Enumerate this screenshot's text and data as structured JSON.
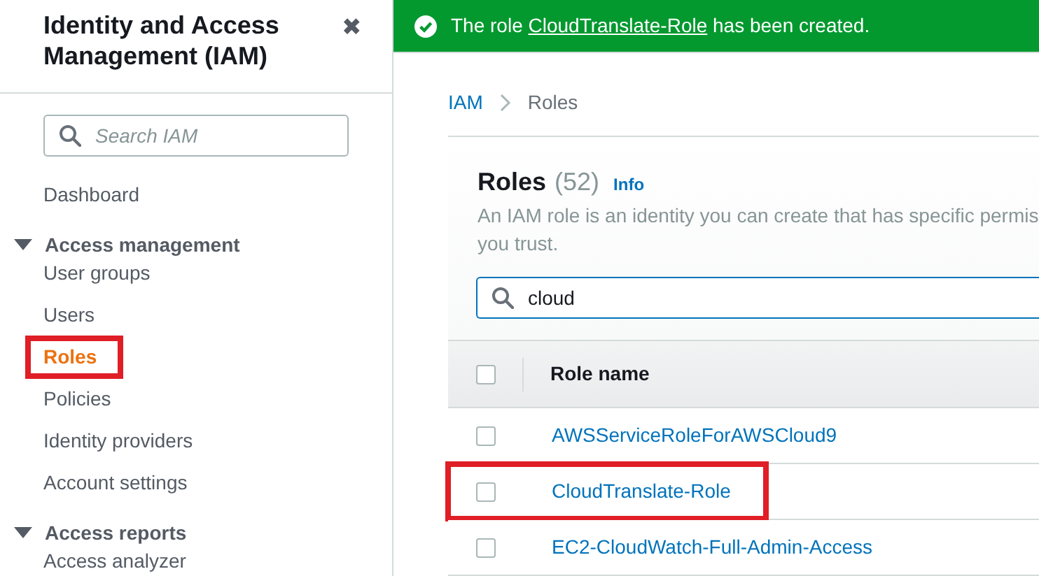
{
  "sidebar": {
    "title": "Identity and Access Management (IAM)",
    "close": "✖",
    "search": {
      "placeholder": "Search IAM"
    },
    "items": [
      {
        "kind": "link",
        "label": "Dashboard",
        "selected": false,
        "highlighted": false
      },
      {
        "kind": "section",
        "label": "Access management",
        "expanded": true,
        "children": [
          {
            "kind": "link",
            "label": "User groups",
            "selected": false,
            "highlighted": false
          },
          {
            "kind": "link",
            "label": "Users",
            "selected": false,
            "highlighted": false
          },
          {
            "kind": "link",
            "label": "Roles",
            "selected": true,
            "highlighted": true
          },
          {
            "kind": "link",
            "label": "Policies",
            "selected": false,
            "highlighted": false
          },
          {
            "kind": "link",
            "label": "Identity providers",
            "selected": false,
            "highlighted": false
          },
          {
            "kind": "link",
            "label": "Account settings",
            "selected": false,
            "highlighted": false
          }
        ]
      },
      {
        "kind": "section",
        "label": "Access reports",
        "expanded": true,
        "children": [
          {
            "kind": "link",
            "label": "Access analyzer",
            "selected": false,
            "highlighted": false
          }
        ]
      }
    ]
  },
  "banner": {
    "before": "The role ",
    "link": "CloudTranslate-Role",
    "after": " has been created."
  },
  "breadcrumb": [
    {
      "label": "IAM",
      "current": false
    },
    {
      "label": "Roles",
      "current": true
    }
  ],
  "roles_panel": {
    "title": "Roles",
    "count": "(52)",
    "info": "Info",
    "description_lines": [
      "An IAM role is an identity you can create that has specific permis",
      "you trust."
    ],
    "search": {
      "value": "cloud"
    },
    "table": {
      "select_all": {
        "checked": false
      },
      "columns": [
        "Role name"
      ],
      "rows": [
        {
          "name": "AWSServiceRoleForAWSCloud9",
          "selected": false,
          "highlighted": false
        },
        {
          "name": "CloudTranslate-Role",
          "selected": false,
          "highlighted": true
        },
        {
          "name": "EC2-CloudWatch-Full-Admin-Access",
          "selected": false,
          "highlighted": false
        }
      ]
    }
  }
}
